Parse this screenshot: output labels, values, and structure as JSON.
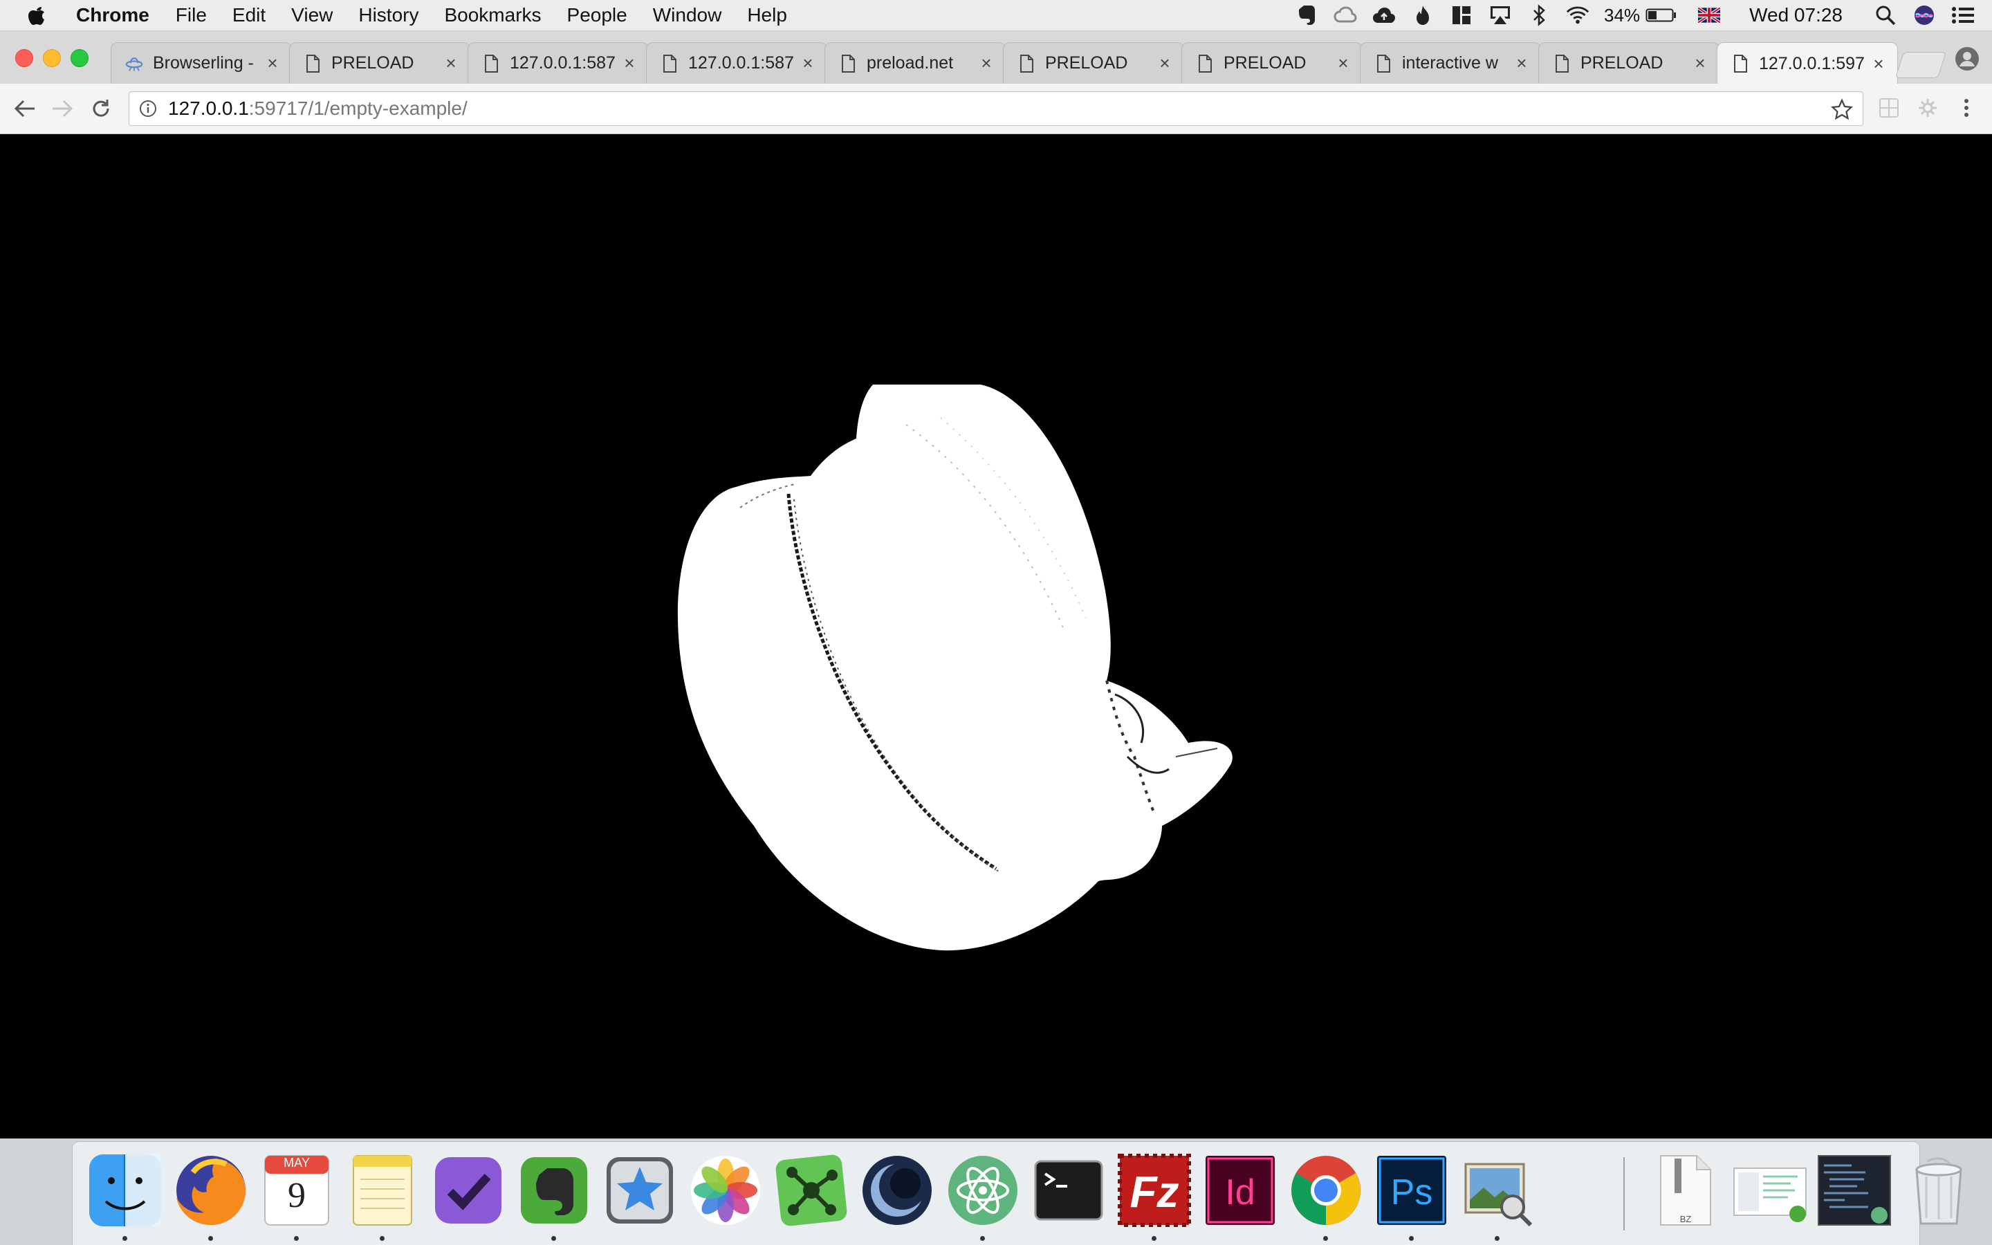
{
  "menubar": {
    "app_name": "Chrome",
    "menus": [
      "File",
      "Edit",
      "View",
      "History",
      "Bookmarks",
      "People",
      "Window",
      "Help"
    ],
    "status_icons": [
      "evernote-icon",
      "creative-cloud-icon",
      "cloud-upload-icon",
      "flame-icon",
      "layout-icon",
      "airplay-icon",
      "bluetooth-icon",
      "wifi-icon"
    ],
    "battery_percent": "34%",
    "input_source": "uk-flag-icon",
    "clock": "Wed 07:28"
  },
  "tabs": [
    {
      "title": "Browserling -",
      "icon": "ufo-icon",
      "active": false
    },
    {
      "title": "PRELOAD",
      "icon": "page-icon",
      "active": false
    },
    {
      "title": "127.0.0.1:587",
      "icon": "page-icon",
      "active": false
    },
    {
      "title": "127.0.0.1:587",
      "icon": "page-icon",
      "active": false
    },
    {
      "title": "preload.net",
      "icon": "page-icon",
      "active": false
    },
    {
      "title": "PRELOAD",
      "icon": "page-icon",
      "active": false
    },
    {
      "title": "PRELOAD",
      "icon": "page-icon",
      "active": false
    },
    {
      "title": "interactive w",
      "icon": "page-icon",
      "active": false
    },
    {
      "title": "PRELOAD",
      "icon": "page-icon",
      "active": false
    },
    {
      "title": "127.0.0.1:597",
      "icon": "page-icon",
      "active": true
    }
  ],
  "toolbar": {
    "url_host": "127.0.0.1",
    "url_path": ":59717/1/empty-example/"
  },
  "content": {
    "background": "#000000",
    "object_color": "#ffffff"
  },
  "dock": {
    "apps": [
      {
        "name": "finder",
        "running": true
      },
      {
        "name": "firefox",
        "running": true
      },
      {
        "name": "calendar",
        "running": true
      },
      {
        "name": "notes",
        "running": true
      },
      {
        "name": "omnifocus",
        "running": false
      },
      {
        "name": "evernote",
        "running": true
      },
      {
        "name": "script-editor",
        "running": false
      },
      {
        "name": "photos",
        "running": false
      },
      {
        "name": "mindnode",
        "running": false
      },
      {
        "name": "cinema4d",
        "running": false
      },
      {
        "name": "atom",
        "running": true
      },
      {
        "name": "terminal",
        "running": false
      },
      {
        "name": "filezilla",
        "running": true
      },
      {
        "name": "indesign",
        "running": false
      },
      {
        "name": "chrome",
        "running": true
      },
      {
        "name": "photoshop",
        "running": true
      },
      {
        "name": "preview",
        "running": true
      }
    ],
    "calendar_month": "MAY",
    "calendar_day": "9",
    "document_label": "BZ"
  }
}
